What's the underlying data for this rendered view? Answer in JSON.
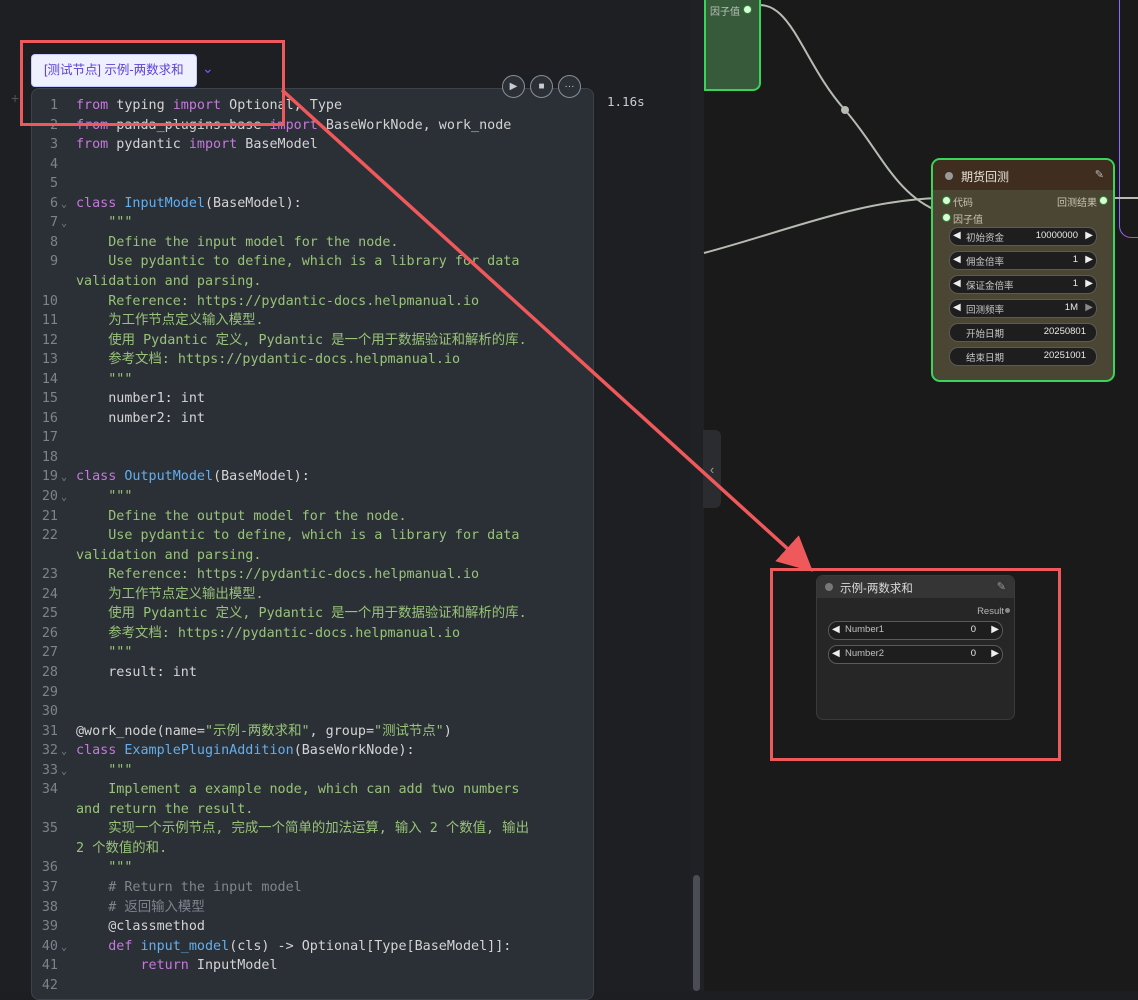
{
  "pill_label": "[测试节点] 示例-两数求和",
  "timing": "1.16s",
  "code_lines": [
    {
      "n": "1",
      "h": "<span class=\"k\">from</span> typing <span class=\"k\">import</span> Optional, Type"
    },
    {
      "n": "2",
      "h": "<span class=\"k\">from</span> panda_plugins.base <span class=\"k\">import</span> BaseWorkNode, work_node"
    },
    {
      "n": "3",
      "h": "<span class=\"k\">from</span> pydantic <span class=\"k\">import</span> BaseModel"
    },
    {
      "n": "4",
      "h": ""
    },
    {
      "n": "5",
      "h": ""
    },
    {
      "n": "6",
      "f": true,
      "h": "<span class=\"k\">class</span> <span class=\"c\">InputModel</span>(BaseModel):"
    },
    {
      "n": "7",
      "f": true,
      "h": "    <span class=\"s\">\"\"\"</span>"
    },
    {
      "n": "8",
      "h": "    <span class=\"s\">Define the input model for the node.</span>"
    },
    {
      "n": "9",
      "h": "    <span class=\"s\">Use pydantic to define, which is a library for data</span>"
    },
    {
      "n": "",
      "h": "<span class=\"s\">validation and parsing.</span>"
    },
    {
      "n": "10",
      "h": "    <span class=\"s\">Reference: https://pydantic-docs.helpmanual.io</span>"
    },
    {
      "n": "11",
      "h": "    <span class=\"s\">为工作节点定义输入模型.</span>"
    },
    {
      "n": "12",
      "h": "    <span class=\"s\">使用 Pydantic 定义, Pydantic 是一个用于数据验证和解析的库.</span>"
    },
    {
      "n": "13",
      "h": "    <span class=\"s\">参考文档: https://pydantic-docs.helpmanual.io</span>"
    },
    {
      "n": "14",
      "h": "    <span class=\"s\">\"\"\"</span>"
    },
    {
      "n": "15",
      "h": "    number1: int"
    },
    {
      "n": "16",
      "h": "    number2: int"
    },
    {
      "n": "17",
      "h": ""
    },
    {
      "n": "18",
      "h": ""
    },
    {
      "n": "19",
      "f": true,
      "h": "<span class=\"k\">class</span> <span class=\"c\">OutputModel</span>(BaseModel):"
    },
    {
      "n": "20",
      "f": true,
      "h": "    <span class=\"s\">\"\"\"</span>"
    },
    {
      "n": "21",
      "h": "    <span class=\"s\">Define the output model for the node.</span>"
    },
    {
      "n": "22",
      "h": "    <span class=\"s\">Use pydantic to define, which is a library for data</span>"
    },
    {
      "n": "",
      "h": "<span class=\"s\">validation and parsing.</span>"
    },
    {
      "n": "23",
      "h": "    <span class=\"s\">Reference: https://pydantic-docs.helpmanual.io</span>"
    },
    {
      "n": "24",
      "h": "    <span class=\"s\">为工作节点定义输出模型.</span>"
    },
    {
      "n": "25",
      "h": "    <span class=\"s\">使用 Pydantic 定义, Pydantic 是一个用于数据验证和解析的库.</span>"
    },
    {
      "n": "26",
      "h": "    <span class=\"s\">参考文档: https://pydantic-docs.helpmanual.io</span>"
    },
    {
      "n": "27",
      "h": "    <span class=\"s\">\"\"\"</span>"
    },
    {
      "n": "28",
      "h": "    result: int"
    },
    {
      "n": "29",
      "h": ""
    },
    {
      "n": "30",
      "h": ""
    },
    {
      "n": "31",
      "h": "@work_node(name=<span class=\"s\">\"示例-两数求和\"</span>, group=<span class=\"s\">\"测试节点\"</span>)"
    },
    {
      "n": "32",
      "f": true,
      "h": "<span class=\"k\">class</span> <span class=\"c\">ExamplePluginAddition</span>(BaseWorkNode):"
    },
    {
      "n": "33",
      "f": true,
      "h": "    <span class=\"s\">\"\"\"</span>"
    },
    {
      "n": "34",
      "h": "    <span class=\"s\">Implement a example node, which can add two numbers</span>"
    },
    {
      "n": "",
      "h": "<span class=\"s\">and return the result.</span>"
    },
    {
      "n": "35",
      "h": "    <span class=\"s\">实现一个示例节点, 完成一个简单的加法运算, 输入 2 个数值, 输出</span>"
    },
    {
      "n": "",
      "h": "<span class=\"s\">2 个数值的和.</span>"
    },
    {
      "n": "36",
      "h": "    <span class=\"s\">\"\"\"</span>"
    },
    {
      "n": "37",
      "h": "    <span class=\"cm\"># Return the input model</span>"
    },
    {
      "n": "38",
      "h": "    <span class=\"cm\"># 返回输入模型</span>"
    },
    {
      "n": "39",
      "h": "    @classmethod"
    },
    {
      "n": "40",
      "f": true,
      "h": "    <span class=\"k\">def</span> <span class=\"c\">input_model</span>(cls) -> Optional[Type[BaseModel]]:"
    },
    {
      "n": "41",
      "h": "        <span class=\"k\">return</span> InputModel"
    },
    {
      "n": "42",
      "h": ""
    }
  ],
  "top_node": {
    "port_label": "因子值"
  },
  "futures_node": {
    "title": "期货回测",
    "in_code": "代码",
    "in_factor": "因子值",
    "out_result": "回测结果",
    "widgets": [
      {
        "label": "初始资金",
        "value": "10000000"
      },
      {
        "label": "佣金倍率",
        "value": "1"
      },
      {
        "label": "保证金倍率",
        "value": "1"
      },
      {
        "label": "回测频率",
        "value": "1M"
      },
      {
        "label": "开始日期",
        "value": "20250801"
      },
      {
        "label": "结束日期",
        "value": "20251001"
      }
    ]
  },
  "sum_node": {
    "title": "示例-两数求和",
    "out_result": "Result",
    "widgets": [
      {
        "label": "Number1",
        "value": "0"
      },
      {
        "label": "Number2",
        "value": "0"
      }
    ]
  },
  "colors": {
    "annotation_red": "#f0595b",
    "node_border_green": "#38d65a"
  },
  "icons": [
    "chevron-down-icon",
    "play-icon",
    "stop-icon",
    "more-icon",
    "edit-icon",
    "chevron-left-icon"
  ]
}
